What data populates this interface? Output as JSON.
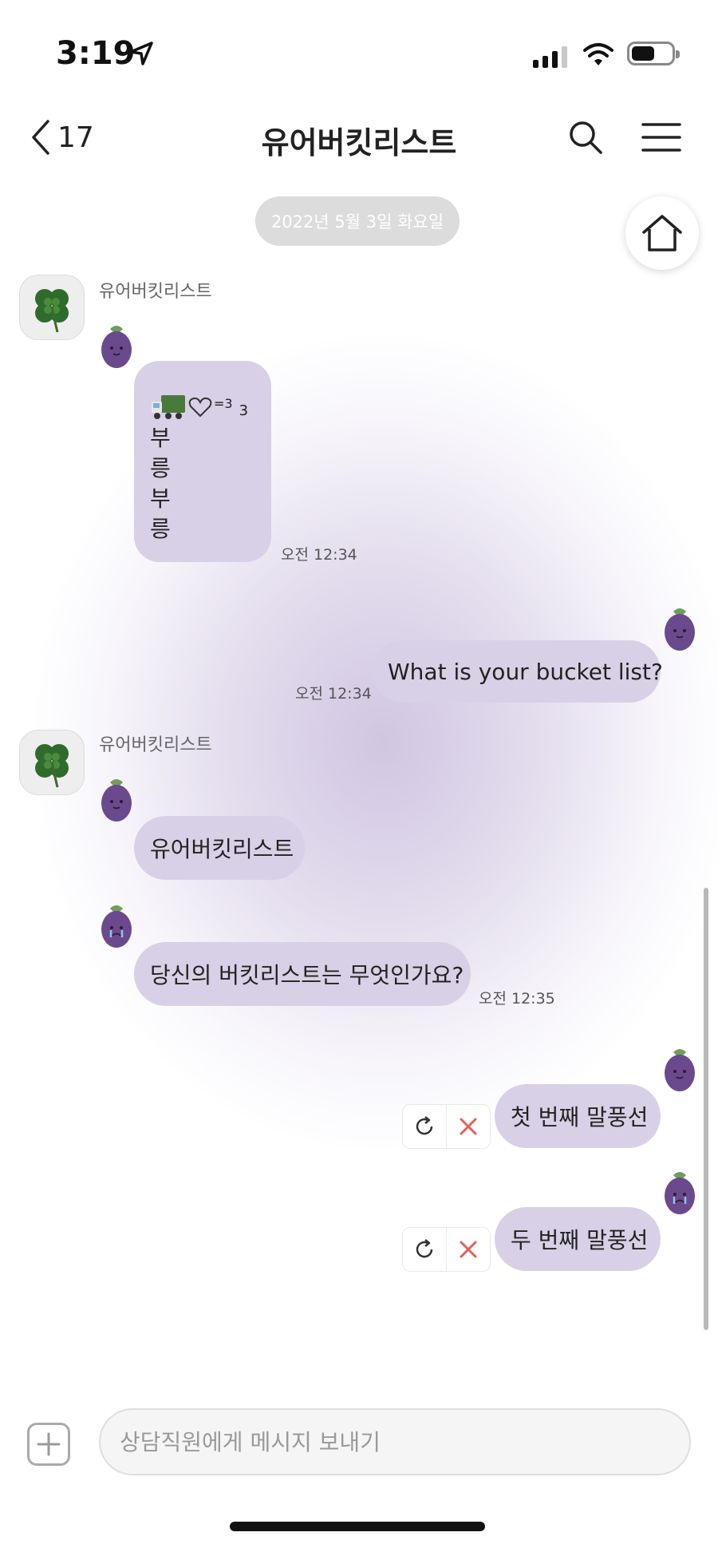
{
  "status_bar": {
    "time": "3:19"
  },
  "header": {
    "back_count": "17",
    "title": "유어버킷리스트"
  },
  "date_divider": "2022년 5월 3일 화요일",
  "messages": {
    "group1": {
      "sender": "유어버킷리스트",
      "top_text": "=3",
      "top_sub": "3",
      "vertical_chars": [
        "부",
        "릉",
        "부",
        "릉"
      ],
      "time": "오전 12:34"
    },
    "user1": {
      "text": "What is your bucket list?",
      "time": "오전 12:34"
    },
    "group2": {
      "sender": "유어버킷리스트",
      "bubble1": "유어버킷리스트",
      "bubble2": "당신의 버킷리스트는 무엇인가요?",
      "time": "오전 12:35"
    },
    "user2": {
      "text": "첫 번째 말풍선"
    },
    "user3": {
      "text": "두 번째 말풍선"
    }
  },
  "input": {
    "placeholder": "상담직원에게 메시지 보내기"
  },
  "colors": {
    "bubble": "#d8d0e6",
    "accent_red": "#e0605a",
    "eggplant": "#6a4a8c"
  }
}
